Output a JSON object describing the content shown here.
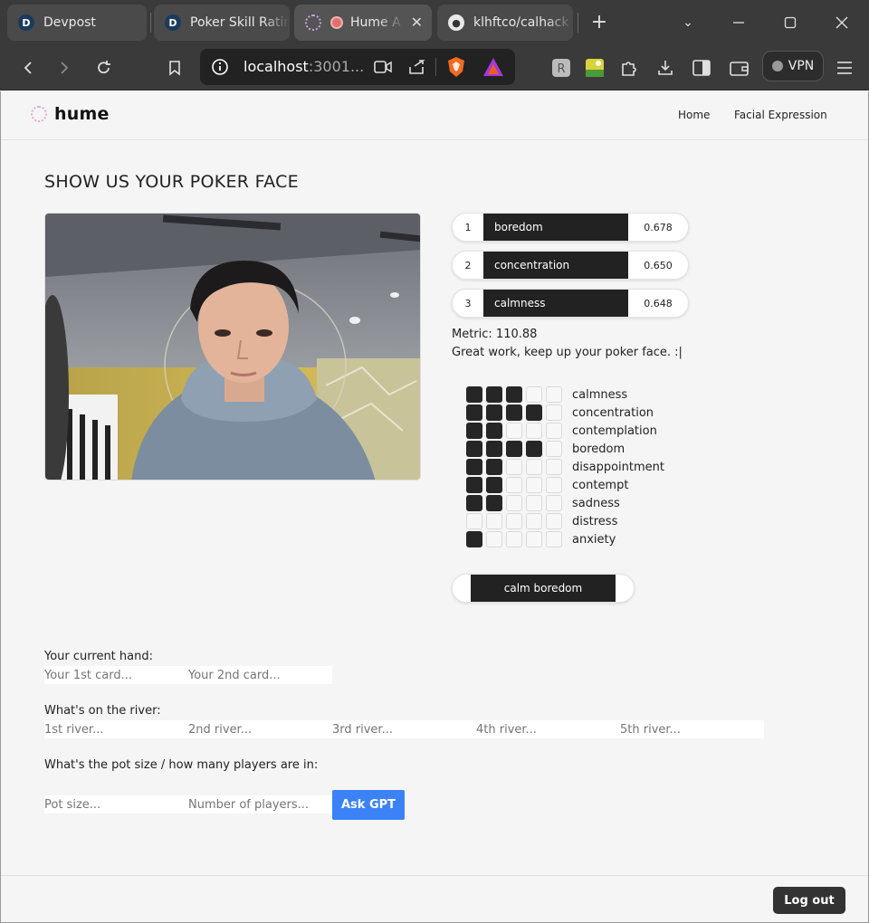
{
  "browser": {
    "tabs": [
      {
        "title": "Devpost",
        "icon": "devpost-icon"
      },
      {
        "title": "Poker Skill Ratin",
        "icon": "devpost-icon"
      },
      {
        "title": "Hume A",
        "icon": "hume-icon"
      },
      {
        "title": "klhftco/calhack",
        "icon": "github-icon"
      }
    ],
    "url_host": "localhost",
    "url_rest": ":3001...",
    "vpn_label": "VPN"
  },
  "nav": {
    "logo": "hume",
    "links": [
      "Home",
      "Facial Expression"
    ]
  },
  "page_title": "SHOW US YOUR POKER FACE",
  "top_emotions": [
    {
      "rank": "1",
      "name": "boredom",
      "score": "0.678"
    },
    {
      "rank": "2",
      "name": "concentration",
      "score": "0.650"
    },
    {
      "rank": "3",
      "name": "calmness",
      "score": "0.648"
    }
  ],
  "metric": "Metric: 110.88",
  "message": "Great work, keep up your poker face. :|",
  "emotion_levels": [
    {
      "name": "calmness",
      "level": 3
    },
    {
      "name": "concentration",
      "level": 4
    },
    {
      "name": "contemplation",
      "level": 2
    },
    {
      "name": "boredom",
      "level": 4
    },
    {
      "name": "disappointment",
      "level": 2
    },
    {
      "name": "contempt",
      "level": 2
    },
    {
      "name": "sadness",
      "level": 2
    },
    {
      "name": "distress",
      "level": 0
    },
    {
      "name": "anxiety",
      "level": 1
    }
  ],
  "emotion_scale_max": 5,
  "combo_label": "calm boredom",
  "form": {
    "hand_label": "Your current hand:",
    "hand_placeholders": [
      "Your 1st card...",
      "Your 2nd card..."
    ],
    "river_label": "What's on the river:",
    "river_placeholders": [
      "1st river...",
      "2nd river...",
      "3rd river...",
      "4th river...",
      "5th river..."
    ],
    "pot_label": "What's the pot size / how many players are in:",
    "pot_placeholder": "Pot size...",
    "players_placeholder": "Number of players...",
    "ask_button": "Ask GPT"
  },
  "logout_label": "Log out",
  "colors": {
    "accent_blue": "#3b82f6",
    "pill_dark": "#222222"
  }
}
